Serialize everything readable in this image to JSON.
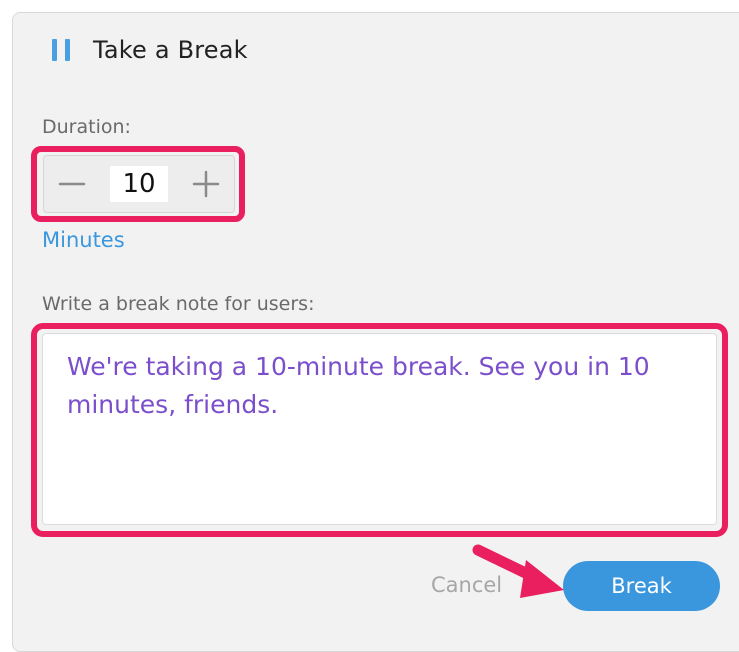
{
  "dialog": {
    "title": "Take a Break",
    "icon": "pause-icon"
  },
  "duration": {
    "label": "Duration:",
    "value": "10",
    "decrement_icon": "minus-icon",
    "increment_icon": "plus-icon",
    "unit": "Minutes"
  },
  "note": {
    "label": "Write a break note for users:",
    "text": "We're taking a 10-minute break. See you in 10 minutes, friends."
  },
  "actions": {
    "cancel_label": "Cancel",
    "break_label": "Break"
  },
  "colors": {
    "accent_blue": "#3a97dd",
    "highlight_pink": "#ea1f5f",
    "note_text_purple": "#7b4fcb"
  }
}
